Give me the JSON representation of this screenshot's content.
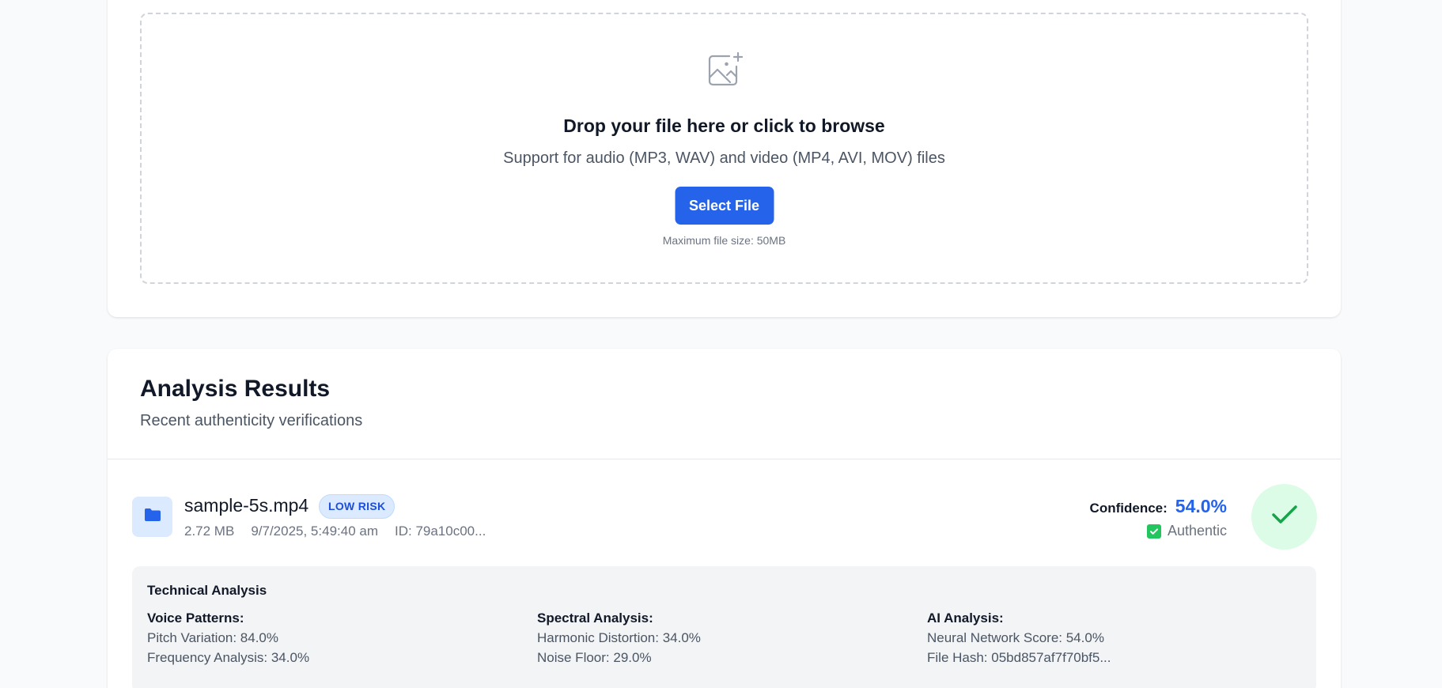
{
  "upload": {
    "title": "Drop your file here or click to browse",
    "subtitle": "Support for audio (MP3, WAV) and video (MP4, AVI, MOV) files",
    "button_label": "Select File",
    "max_size": "Maximum file size: 50MB",
    "icon": "image-plus-icon"
  },
  "results": {
    "title": "Analysis Results",
    "subtitle": "Recent authenticity verifications",
    "items": [
      {
        "file_name": "sample-5s.mp4",
        "risk_badge": "LOW RISK",
        "size": "2.72 MB",
        "timestamp": "9/7/2025, 5:49:40 am",
        "id": "ID: 79a10c00...",
        "confidence_label": "Confidence:",
        "confidence_value": "54.0%",
        "status": "Authentic",
        "icon": "folder-icon",
        "verdict_icon": "checkmark-icon",
        "technical": {
          "title": "Technical Analysis",
          "voice": {
            "heading": "Voice Patterns:",
            "line1": "Pitch Variation: 84.0%",
            "line2": "Frequency Analysis: 34.0%"
          },
          "spectral": {
            "heading": "Spectral Analysis:",
            "line1": "Harmonic Distortion: 34.0%",
            "line2": "Noise Floor: 29.0%"
          },
          "ai": {
            "heading": "AI Analysis:",
            "line1": "Neural Network Score: 54.0%",
            "line2": "File Hash: 05bd857af7f70bf5..."
          }
        }
      }
    ]
  },
  "colors": {
    "accent": "#2563eb",
    "success": "#22c55e",
    "success_bg": "#dcfce7",
    "badge_bg": "#dbeafe"
  }
}
